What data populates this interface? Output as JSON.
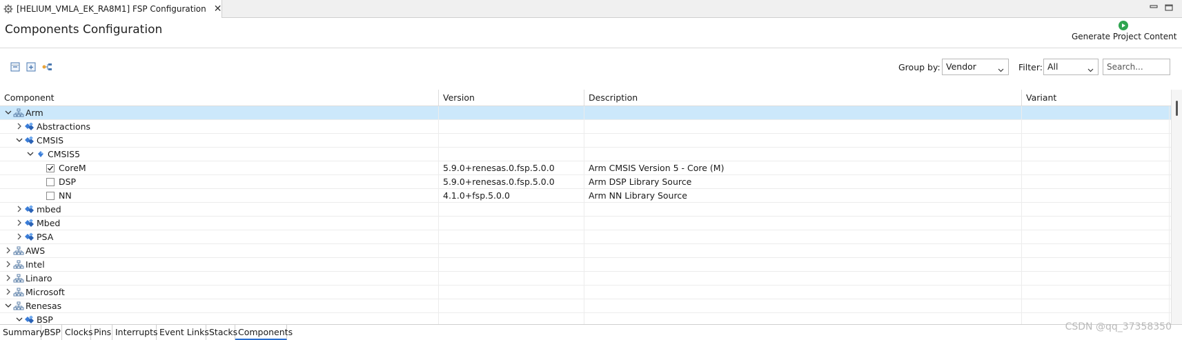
{
  "editor_tab": {
    "title": "[HELIUM_VMLA_EK_RA8M1] FSP Configuration",
    "icon": "gear-icon",
    "close_icon": "close-icon"
  },
  "header": {
    "title": "Components Configuration",
    "generate_label": "Generate Project Content",
    "generate_icon": "play-icon",
    "accent": "#2ea44f"
  },
  "toolbar": {
    "group_by_label": "Group by:",
    "group_by_value": "Vendor",
    "filter_label": "Filter:",
    "filter_value": "All",
    "search_placeholder": "Search..."
  },
  "table": {
    "columns": [
      "Component",
      "Version",
      "Description",
      "Variant"
    ],
    "rows": [
      {
        "name": "Arm",
        "expanded": true,
        "level": 0,
        "icon": "vendor-icon",
        "selected": true,
        "version": "",
        "description": ""
      },
      {
        "name": "Abstractions",
        "expanded": false,
        "level": 1,
        "icon": "component-group-icon",
        "version": "",
        "description": ""
      },
      {
        "name": "CMSIS",
        "expanded": true,
        "level": 1,
        "icon": "component-group-icon",
        "version": "",
        "description": ""
      },
      {
        "name": "CMSIS5",
        "expanded": true,
        "level": 2,
        "icon": "component-icon",
        "version": "",
        "description": ""
      },
      {
        "name": "CoreM",
        "level": 3,
        "checked": true,
        "version": "5.9.0+renesas.0.fsp.5.0.0",
        "description": "Arm CMSIS Version 5 - Core (M)"
      },
      {
        "name": "DSP",
        "level": 3,
        "checked": false,
        "version": "5.9.0+renesas.0.fsp.5.0.0",
        "description": "Arm DSP Library Source"
      },
      {
        "name": "NN",
        "level": 3,
        "checked": false,
        "version": "4.1.0+fsp.5.0.0",
        "description": "Arm NN Library Source"
      },
      {
        "name": "mbed",
        "expanded": false,
        "level": 1,
        "icon": "component-group-icon",
        "version": "",
        "description": ""
      },
      {
        "name": "Mbed",
        "expanded": false,
        "level": 1,
        "icon": "component-group-icon",
        "version": "",
        "description": ""
      },
      {
        "name": "PSA",
        "expanded": false,
        "level": 1,
        "icon": "component-group-icon",
        "version": "",
        "description": ""
      },
      {
        "name": "AWS",
        "expanded": false,
        "level": 0,
        "icon": "vendor-icon",
        "version": "",
        "description": ""
      },
      {
        "name": "Intel",
        "expanded": false,
        "level": 0,
        "icon": "vendor-icon",
        "version": "",
        "description": ""
      },
      {
        "name": "Linaro",
        "expanded": false,
        "level": 0,
        "icon": "vendor-icon",
        "version": "",
        "description": ""
      },
      {
        "name": "Microsoft",
        "expanded": false,
        "level": 0,
        "icon": "vendor-icon",
        "version": "",
        "description": ""
      },
      {
        "name": "Renesas",
        "expanded": true,
        "level": 0,
        "icon": "vendor-icon",
        "version": "",
        "description": ""
      },
      {
        "name": "BSP",
        "expanded": true,
        "level": 1,
        "icon": "component-group-icon",
        "version": "",
        "description": ""
      }
    ]
  },
  "bottom_tabs": [
    "Summary",
    "BSP",
    "Clocks",
    "Pins",
    "Interrupts",
    "Event Links",
    "Stacks",
    "Components"
  ],
  "active_bottom_tab": "Components",
  "watermark": "CSDN @qq_37358350"
}
